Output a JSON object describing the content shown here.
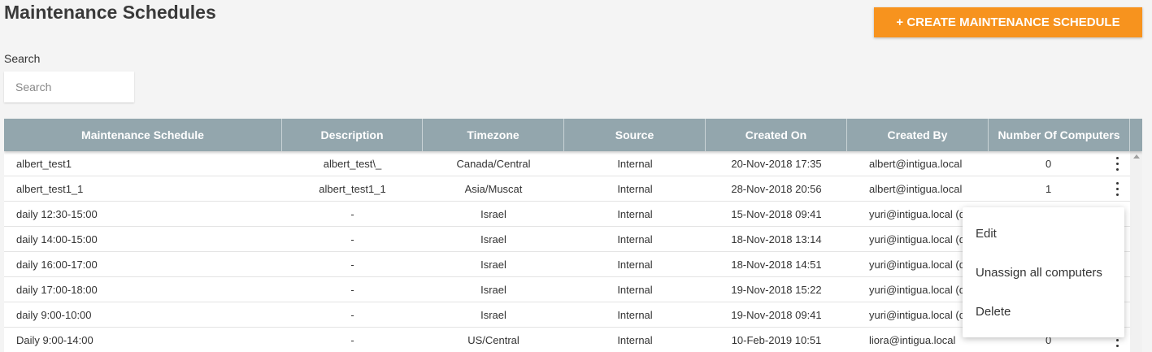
{
  "header": {
    "title": "Maintenance Schedules",
    "create_button": "+ CREATE MAINTENANCE SCHEDULE"
  },
  "search": {
    "label": "Search",
    "placeholder": "Search"
  },
  "table": {
    "columns": [
      "Maintenance Schedule",
      "Description",
      "Timezone",
      "Source",
      "Created On",
      "Created By",
      "Number Of Computers"
    ],
    "rows": [
      {
        "name": "albert_test1",
        "description": "albert_test\\_",
        "timezone": "Canada/Central",
        "source": "Internal",
        "created_on": "20-Nov-2018 17:35",
        "created_by": "albert@intigua.local",
        "computers": "0"
      },
      {
        "name": "albert_test1_1",
        "description": "albert_test1_1",
        "timezone": "Asia/Muscat",
        "source": "Internal",
        "created_on": "28-Nov-2018 20:56",
        "created_by": "albert@intigua.local",
        "computers": "1"
      },
      {
        "name": "daily 12:30-15:00",
        "description": "-",
        "timezone": "Israel",
        "source": "Internal",
        "created_on": "15-Nov-2018 09:41",
        "created_by": "yuri@intigua.local (delet",
        "computers": ""
      },
      {
        "name": "daily 14:00-15:00",
        "description": "-",
        "timezone": "Israel",
        "source": "Internal",
        "created_on": "18-Nov-2018 13:14",
        "created_by": "yuri@intigua.local (delet",
        "computers": ""
      },
      {
        "name": "daily 16:00-17:00",
        "description": "-",
        "timezone": "Israel",
        "source": "Internal",
        "created_on": "18-Nov-2018 14:51",
        "created_by": "yuri@intigua.local (delet",
        "computers": ""
      },
      {
        "name": "daily 17:00-18:00",
        "description": "-",
        "timezone": "Israel",
        "source": "Internal",
        "created_on": "19-Nov-2018 15:22",
        "created_by": "yuri@intigua.local (delet",
        "computers": ""
      },
      {
        "name": "daily 9:00-10:00",
        "description": "-",
        "timezone": "Israel",
        "source": "Internal",
        "created_on": "19-Nov-2018 09:41",
        "created_by": "yuri@intigua.local (delet",
        "computers": ""
      },
      {
        "name": "Daily 9:00-14:00",
        "description": "-",
        "timezone": "US/Central",
        "source": "Internal",
        "created_on": "10-Feb-2019 10:51",
        "created_by": "liora@intigua.local",
        "computers": "0"
      }
    ]
  },
  "context_menu": {
    "items": [
      "Edit",
      "Unassign all computers",
      "Delete"
    ]
  },
  "colors": {
    "accent": "#f7931e",
    "table_header": "#93a6ad",
    "background": "#f4f4f4"
  }
}
